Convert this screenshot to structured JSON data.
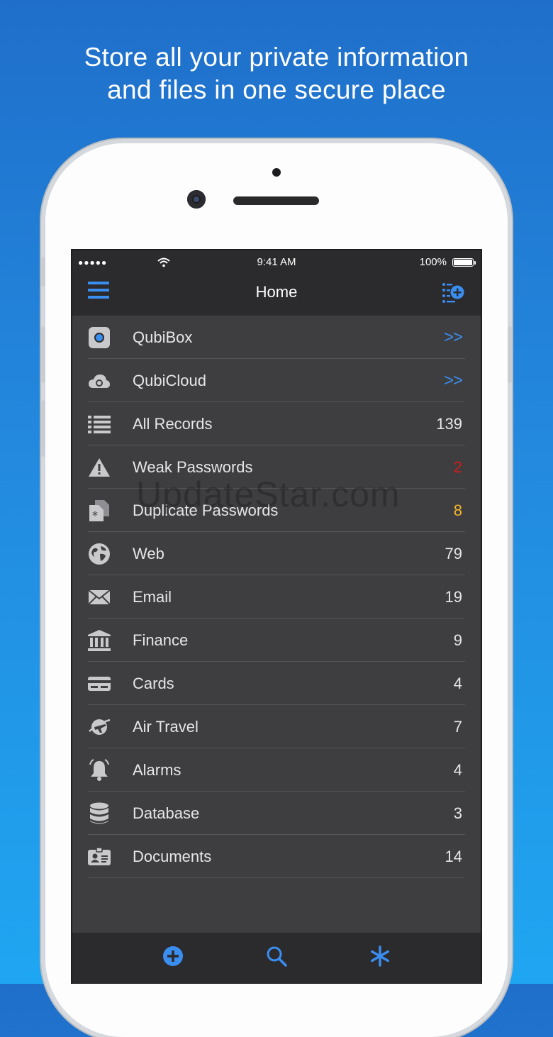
{
  "headline": {
    "line1": "Store all your private information",
    "line2": "and files in one secure place"
  },
  "status_bar": {
    "signal": "●●●●●",
    "time": "9:41 AM",
    "battery": "100%"
  },
  "nav": {
    "title": "Home",
    "left_icon": "hamburger-menu-icon",
    "right_icon": "add-filter-icon"
  },
  "items": [
    {
      "label": "QubiBox",
      "value": ">>",
      "icon": "qubibox-icon",
      "style": "chevron"
    },
    {
      "label": "QubiCloud",
      "value": ">>",
      "icon": "cloud-icon",
      "style": "chevron"
    },
    {
      "label": "All Records",
      "value": "139",
      "icon": "list-icon",
      "style": "normal"
    },
    {
      "label": "Weak Passwords",
      "value": "2",
      "icon": "warning-icon",
      "style": "red"
    },
    {
      "label": "Duplicate Passwords",
      "value": "8",
      "icon": "duplicate-icon",
      "style": "yellow"
    },
    {
      "label": "Web",
      "value": "79",
      "icon": "globe-icon",
      "style": "normal"
    },
    {
      "label": "Email",
      "value": "19",
      "icon": "envelope-icon",
      "style": "normal"
    },
    {
      "label": "Finance",
      "value": "9",
      "icon": "bank-icon",
      "style": "normal"
    },
    {
      "label": "Cards",
      "value": "4",
      "icon": "credit-card-icon",
      "style": "normal"
    },
    {
      "label": "Air Travel",
      "value": "7",
      "icon": "plane-icon",
      "style": "normal"
    },
    {
      "label": "Alarms",
      "value": "4",
      "icon": "bell-icon",
      "style": "normal"
    },
    {
      "label": "Database",
      "value": "3",
      "icon": "database-icon",
      "style": "normal"
    },
    {
      "label": "Documents",
      "value": "14",
      "icon": "id-card-icon",
      "style": "normal"
    }
  ],
  "watermark": "UpdateStar.com",
  "tabbar": {
    "add_icon": "add-circle-icon",
    "search_icon": "search-icon",
    "asterisk_icon": "asterisk-icon"
  },
  "colors": {
    "accent": "#3a8ef0",
    "warning_red": "#d21a1a",
    "warning_yellow": "#f2b52c",
    "list_bg": "#3e3e41",
    "bar_bg": "#2b2b2e"
  }
}
